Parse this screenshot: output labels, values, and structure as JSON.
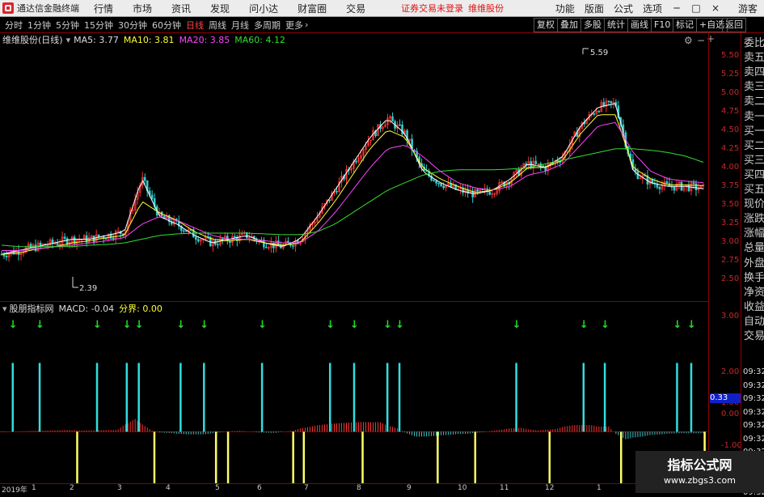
{
  "menubar": {
    "app_title": "通达信金融终端",
    "items": [
      "行情",
      "市场",
      "资讯",
      "发现",
      "问小达",
      "财富圈",
      "交易"
    ],
    "warning": "证券交易未登录",
    "stock": "维维股份",
    "right_items": [
      "功能",
      "版面",
      "公式",
      "选项"
    ],
    "guest": "游客",
    "win_controls": [
      "─",
      "□",
      "×"
    ]
  },
  "toolbar": {
    "periods": [
      "分时",
      "1分钟",
      "5分钟",
      "15分钟",
      "30分钟",
      "60分钟",
      "日线",
      "周线",
      "月线",
      "多周期",
      "更多"
    ],
    "active_period": "日线",
    "more_arrow": "›",
    "right_buttons": [
      "复权",
      "叠加",
      "多股",
      "统计",
      "画线",
      "F10",
      "标记",
      "+自选",
      "返回"
    ]
  },
  "price_header": {
    "title": "维维股份(日线)",
    "ma": [
      {
        "label": "MA5: 3.77",
        "color": "#ffffff"
      },
      {
        "label": "MA10: 3.81",
        "color": "#ffff33"
      },
      {
        "label": "MA20: 3.85",
        "color": "#ff44ff"
      },
      {
        "label": "MA60: 4.12",
        "color": "#33dd33"
      }
    ]
  },
  "macd_header": {
    "title": "股朋指标网",
    "macd": "MACD: -0.04",
    "fenjie": "分界: 0.00"
  },
  "price_axis": [
    "5.50",
    "5.25",
    "5.00",
    "4.75",
    "4.50",
    "4.25",
    "4.00",
    "3.75",
    "3.50",
    "3.25",
    "3.00",
    "2.75",
    "2.50"
  ],
  "macd_axis": [
    "3.00",
    "2.00",
    "1.00",
    "0.00",
    "-1.00"
  ],
  "macd_highlight": "0.33",
  "annotations": {
    "high": "5.59",
    "low": "2.39"
  },
  "sidebar": {
    "labels": [
      "委比",
      "卖五",
      "卖四",
      "卖三",
      "卖二",
      "卖一",
      "买一",
      "买二",
      "买三",
      "买四",
      "买五",
      "现价",
      "涨跌",
      "涨幅",
      "总量",
      "外盘",
      "换手",
      "净资",
      "收益",
      "自动",
      "交易"
    ],
    "times": [
      "09:32",
      "09:32",
      "09:32",
      "09:32",
      "09:32",
      "09:32",
      "09:32",
      "09:32",
      "09:32",
      "09:32"
    ]
  },
  "dates": [
    "2019年",
    "1",
    "2",
    "3",
    "4",
    "5",
    "6",
    "7",
    "8",
    "9",
    "10",
    "11",
    "12",
    "1"
  ],
  "watermark": {
    "title": "指标公式网",
    "url": "www.zbgs3.com"
  },
  "colors": {
    "up": "#ff3333",
    "down": "#33cccc",
    "ma5": "#ffffff",
    "ma10": "#ffff33",
    "ma20": "#ff44ff",
    "ma60": "#33dd33",
    "signal_up": "#33dddd",
    "signal_down": "#ffff66",
    "arrow": "#22dd22",
    "axis": "#c82828"
  },
  "chart_data": {
    "type": "line",
    "title": "维维股份(日线)",
    "series": [
      {
        "name": "MA5",
        "values": [
          2.9,
          2.95,
          3.0,
          3.05,
          3.1,
          3.1,
          3.15,
          3.2,
          3.9,
          3.4,
          3.3,
          3.15,
          3.05,
          3.1,
          3.15,
          3.05,
          3.0,
          3.1,
          3.4,
          3.75,
          4.1,
          4.45,
          4.7,
          4.5,
          4.0,
          3.85,
          3.75,
          3.7,
          3.75,
          3.9,
          4.1,
          4.05,
          4.2,
          4.6,
          4.85,
          4.9,
          4.0,
          3.85,
          3.8,
          3.8,
          3.77
        ]
      },
      {
        "name": "MA10",
        "values": [
          2.9,
          2.92,
          2.97,
          3.0,
          3.05,
          3.08,
          3.12,
          3.15,
          3.6,
          3.45,
          3.35,
          3.2,
          3.1,
          3.08,
          3.1,
          3.05,
          3.02,
          3.05,
          3.3,
          3.6,
          3.95,
          4.3,
          4.55,
          4.45,
          4.05,
          3.9,
          3.8,
          3.72,
          3.75,
          3.85,
          4.05,
          4.05,
          4.15,
          4.5,
          4.75,
          4.75,
          4.05,
          3.9,
          3.82,
          3.82,
          3.81
        ]
      },
      {
        "name": "MA20",
        "values": [
          2.95,
          2.95,
          2.97,
          3.0,
          3.02,
          3.05,
          3.08,
          3.12,
          3.3,
          3.4,
          3.35,
          3.25,
          3.15,
          3.1,
          3.1,
          3.08,
          3.05,
          3.05,
          3.2,
          3.45,
          3.75,
          4.05,
          4.3,
          4.35,
          4.2,
          4.0,
          3.85,
          3.78,
          3.75,
          3.8,
          3.95,
          4.0,
          4.1,
          4.35,
          4.6,
          4.65,
          4.25,
          4.0,
          3.9,
          3.87,
          3.85
        ]
      },
      {
        "name": "MA60",
        "values": [
          3.02,
          3.0,
          3.0,
          3.0,
          3.0,
          3.02,
          3.03,
          3.05,
          3.1,
          3.15,
          3.17,
          3.18,
          3.18,
          3.18,
          3.18,
          3.17,
          3.16,
          3.16,
          3.2,
          3.3,
          3.45,
          3.6,
          3.75,
          3.85,
          3.95,
          4.0,
          4.02,
          4.02,
          4.02,
          4.03,
          4.05,
          4.1,
          4.15,
          4.2,
          4.25,
          4.3,
          4.3,
          4.28,
          4.25,
          4.2,
          4.12
        ]
      }
    ],
    "ylim": [
      2.3,
      5.65
    ],
    "macd_signals": [
      {
        "x": 0.018,
        "v": 2.0
      },
      {
        "x": 0.056,
        "v": 2.0
      },
      {
        "x": 0.137,
        "v": 2.0
      },
      {
        "x": 0.179,
        "v": 2.0
      },
      {
        "x": 0.196,
        "v": 2.0
      },
      {
        "x": 0.255,
        "v": 2.0
      },
      {
        "x": 0.288,
        "v": 2.0
      },
      {
        "x": 0.37,
        "v": 2.0
      },
      {
        "x": 0.466,
        "v": 2.0
      },
      {
        "x": 0.5,
        "v": 2.0
      },
      {
        "x": 0.547,
        "v": 2.0
      },
      {
        "x": 0.564,
        "v": 2.0
      },
      {
        "x": 0.729,
        "v": 2.0
      },
      {
        "x": 0.824,
        "v": 2.0
      },
      {
        "x": 0.854,
        "v": 2.0
      },
      {
        "x": 0.956,
        "v": 2.0
      },
      {
        "x": 0.976,
        "v": 2.0
      },
      {
        "x": 0.109,
        "v": -2.0
      },
      {
        "x": 0.218,
        "v": -2.0
      },
      {
        "x": 0.305,
        "v": -2.0
      },
      {
        "x": 0.322,
        "v": -2.0
      },
      {
        "x": 0.414,
        "v": -2.0
      },
      {
        "x": 0.429,
        "v": -2.0
      },
      {
        "x": 0.512,
        "v": -2.0
      },
      {
        "x": 0.618,
        "v": -2.0
      },
      {
        "x": 0.671,
        "v": -2.0
      },
      {
        "x": 0.776,
        "v": -2.0
      },
      {
        "x": 0.877,
        "v": -2.0
      },
      {
        "x": 0.995,
        "v": -2.0
      }
    ],
    "macd_ylim": [
      -1.5,
      3.4
    ]
  }
}
